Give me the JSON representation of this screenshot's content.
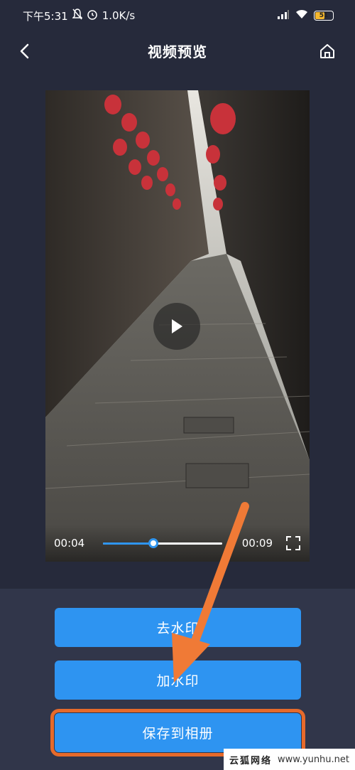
{
  "status_bar": {
    "time": "下午5:31",
    "speed": "1.0K/s",
    "battery": "51"
  },
  "nav": {
    "title": "视频预览"
  },
  "video": {
    "current_time": "00:04",
    "total_time": "00:09",
    "progress": 0.42
  },
  "actions": {
    "remove_watermark": "去水印",
    "add_watermark": "加水印",
    "save_to_album": "保存到相册"
  },
  "watermark": {
    "brand": "云狐网络",
    "url": "www.yunhu.net"
  },
  "colors": {
    "background": "#262a3b",
    "accent": "#2e94f1",
    "highlight": "#e66a2b"
  }
}
